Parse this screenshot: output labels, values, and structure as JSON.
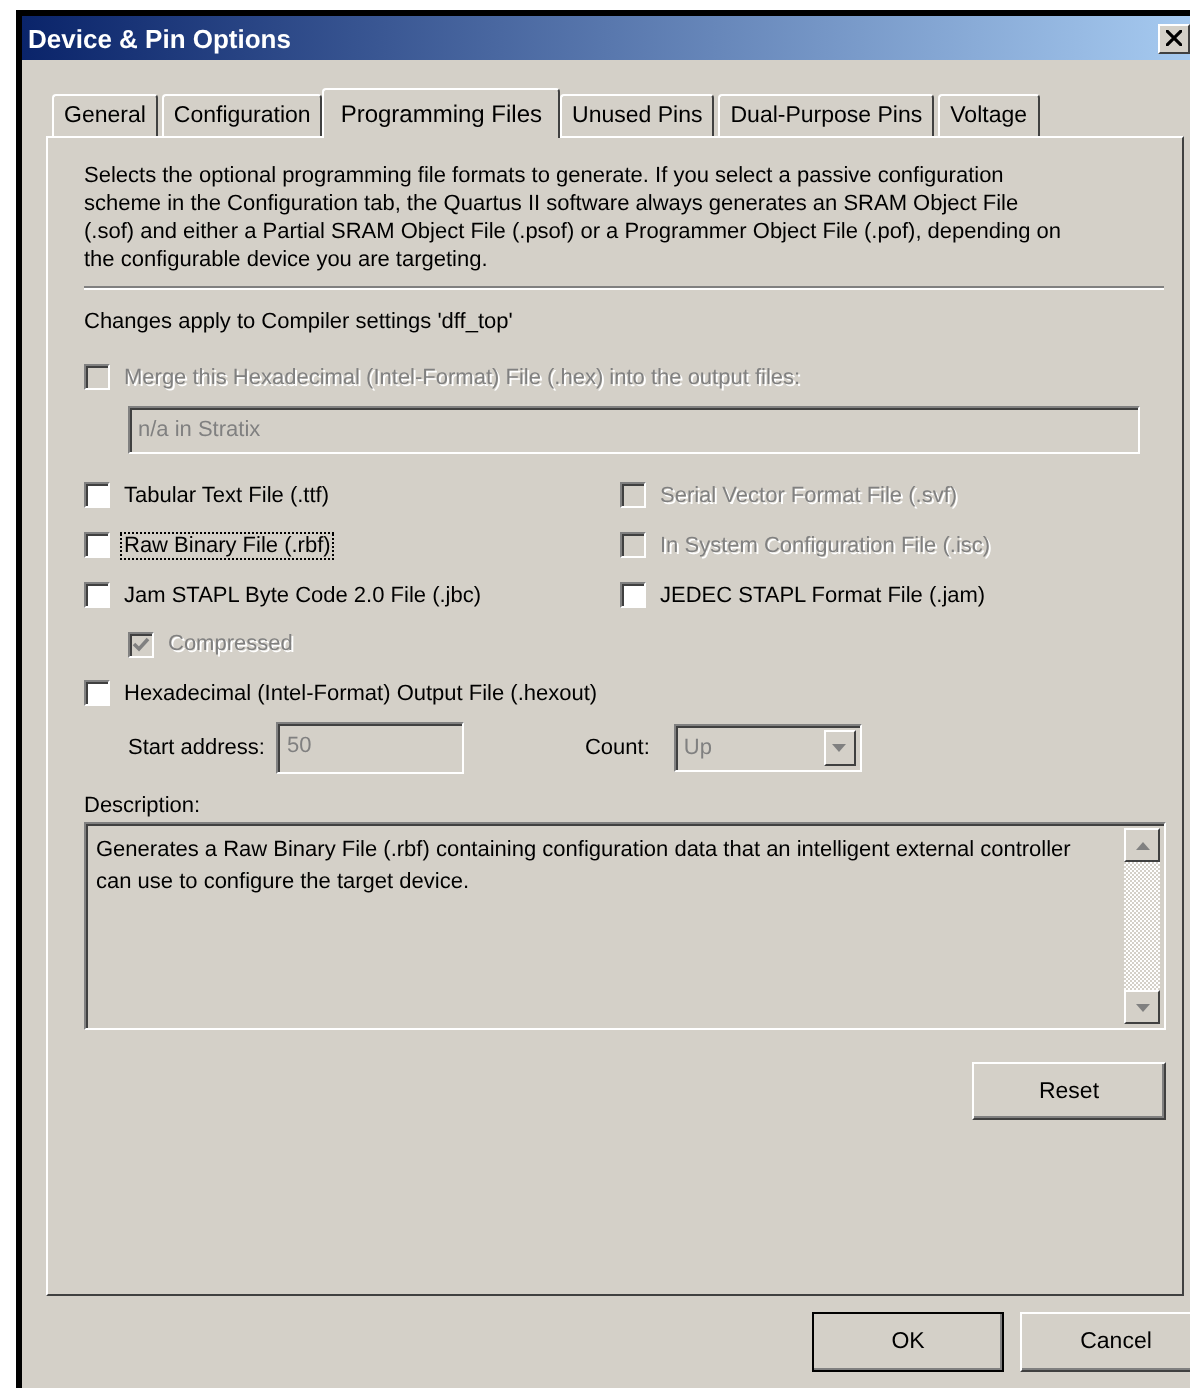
{
  "window": {
    "title": "Device & Pin Options"
  },
  "tabs": [
    {
      "label": "General",
      "selected": false
    },
    {
      "label": "Configuration",
      "selected": false
    },
    {
      "label": "Programming Files",
      "selected": true
    },
    {
      "label": "Unused Pins",
      "selected": false
    },
    {
      "label": "Dual-Purpose Pins",
      "selected": false
    },
    {
      "label": "Voltage",
      "selected": false
    }
  ],
  "intro": "Selects the optional programming file formats to generate. If you select a passive configuration scheme in the Configuration tab, the Quartus II software always generates an SRAM Object File (.sof) and either a Partial SRAM Object File (.psof) or a Programmer Object File (.pof), depending on the configurable device you are targeting.",
  "settings_note": "Changes apply to Compiler settings 'dff_top'",
  "merge": {
    "label": "Merge this Hexadecimal (Intel-Format) File (.hex) into the output files:",
    "checked": false,
    "disabled": true,
    "field_value": "n/a in Stratix",
    "field_disabled": true
  },
  "option_rows": [
    {
      "left": {
        "label": "Tabular Text File (.ttf)",
        "checked": false,
        "disabled": false,
        "focused": false
      },
      "right": {
        "label": "Serial Vector Format File (.svf)",
        "checked": false,
        "disabled": true,
        "focused": false
      }
    },
    {
      "left": {
        "label": "Raw Binary File (.rbf)",
        "checked": false,
        "disabled": false,
        "focused": true
      },
      "right": {
        "label": "In System Configuration File (.isc)",
        "checked": false,
        "disabled": true,
        "focused": false
      }
    },
    {
      "left": {
        "label": "Jam STAPL Byte Code 2.0 File (.jbc)",
        "checked": false,
        "disabled": false,
        "focused": false
      },
      "right": {
        "label": "JEDEC STAPL Format File (.jam)",
        "checked": false,
        "disabled": false,
        "focused": false
      }
    }
  ],
  "compressed": {
    "label": "Compressed",
    "checked": true,
    "disabled": true,
    "focused": false
  },
  "hexout": {
    "label": "Hexadecimal (Intel-Format) Output File (.hexout)",
    "checked": false,
    "disabled": false,
    "focused": false
  },
  "start_address": {
    "label": "Start address:",
    "value": "50",
    "disabled": true
  },
  "count": {
    "label": "Count:",
    "value": "Up",
    "disabled": true
  },
  "description": {
    "label": "Description:",
    "text": "Generates a Raw Binary File (.rbf) containing configuration data that an intelligent external controller can use to configure the target device."
  },
  "reset_button": "Reset",
  "buttons": [
    "OK",
    "Cancel"
  ]
}
